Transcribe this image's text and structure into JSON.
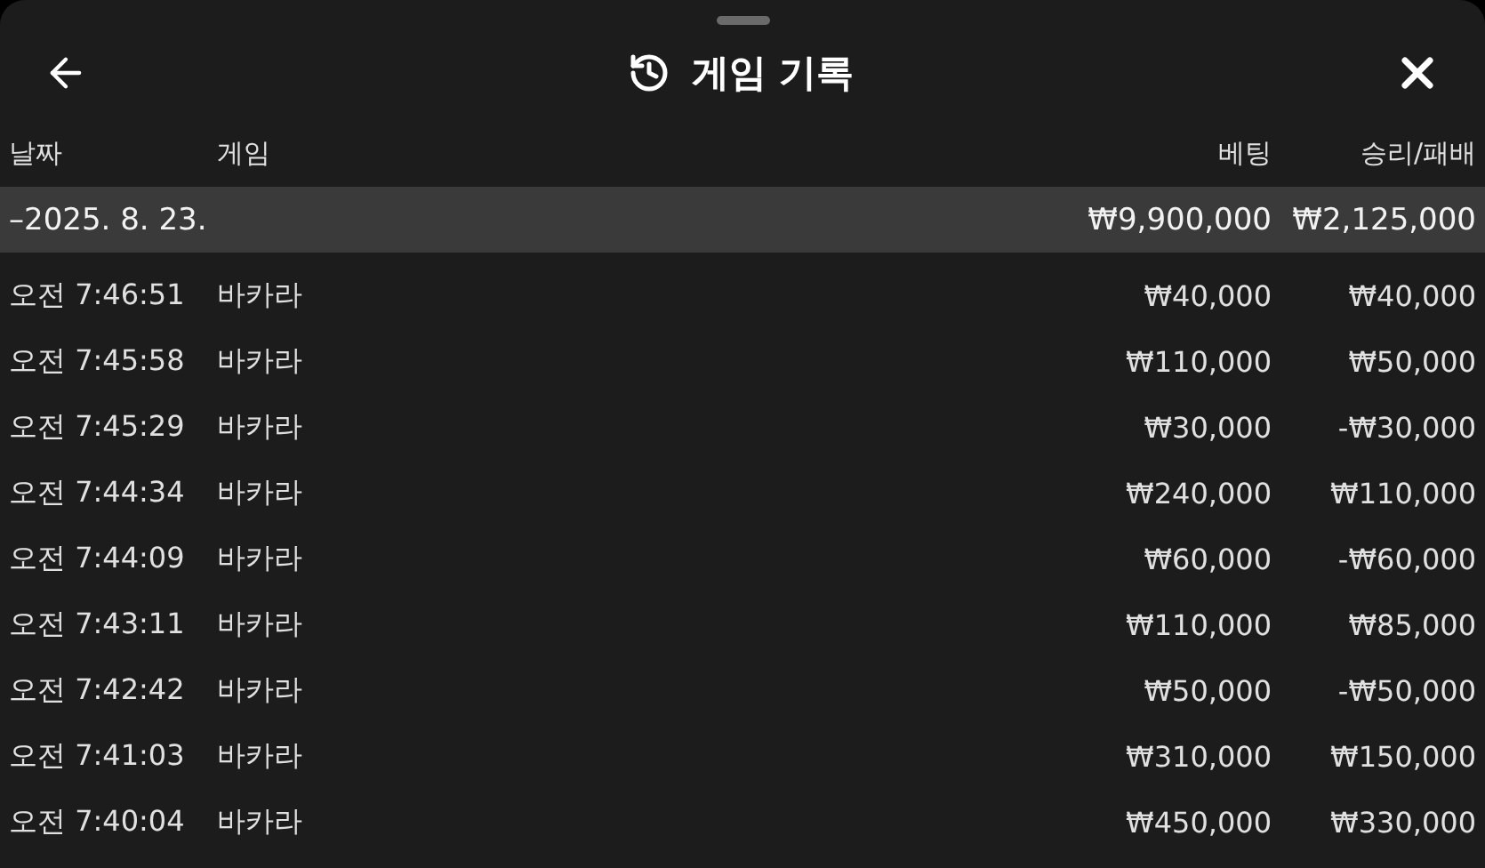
{
  "header": {
    "title": "게임 기록"
  },
  "table": {
    "columns": [
      "날짜",
      "게임",
      "베팅",
      "승리/패배"
    ],
    "group": {
      "label": "–2025. 8. 23.",
      "bet": "₩9,900,000",
      "result": "₩2,125,000"
    },
    "rows": [
      {
        "time": "오전 7:46:51",
        "game": "바카라",
        "bet": "₩40,000",
        "result": "₩40,000"
      },
      {
        "time": "오전 7:45:58",
        "game": "바카라",
        "bet": "₩110,000",
        "result": "₩50,000"
      },
      {
        "time": "오전 7:45:29",
        "game": "바카라",
        "bet": "₩30,000",
        "result": "-₩30,000"
      },
      {
        "time": "오전 7:44:34",
        "game": "바카라",
        "bet": "₩240,000",
        "result": "₩110,000"
      },
      {
        "time": "오전 7:44:09",
        "game": "바카라",
        "bet": "₩60,000",
        "result": "-₩60,000"
      },
      {
        "time": "오전 7:43:11",
        "game": "바카라",
        "bet": "₩110,000",
        "result": "₩85,000"
      },
      {
        "time": "오전 7:42:42",
        "game": "바카라",
        "bet": "₩50,000",
        "result": "-₩50,000"
      },
      {
        "time": "오전 7:41:03",
        "game": "바카라",
        "bet": "₩310,000",
        "result": "₩150,000"
      },
      {
        "time": "오전 7:40:04",
        "game": "바카라",
        "bet": "₩450,000",
        "result": "₩330,000"
      }
    ]
  }
}
